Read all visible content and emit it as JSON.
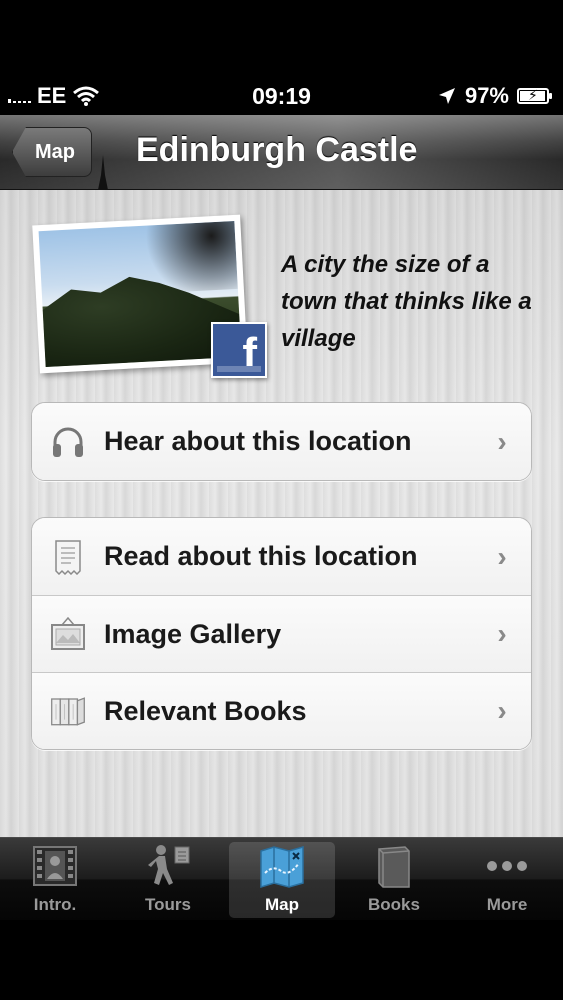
{
  "status_bar": {
    "carrier": "EE",
    "time": "09:19",
    "battery_percent": "97%",
    "battery_level": 0.97
  },
  "nav": {
    "back_label": "Map",
    "title": "Edinburgh Castle"
  },
  "header": {
    "tagline": "A city the size of a town that thinks like a village",
    "facebook_glyph": "f"
  },
  "menu_groups": [
    [
      {
        "label": "Hear about this location",
        "icon": "headphones-icon"
      }
    ],
    [
      {
        "label": "Read about this location",
        "icon": "document-icon"
      },
      {
        "label": "Image Gallery",
        "icon": "picture-icon"
      },
      {
        "label": "Relevant Books",
        "icon": "books-icon"
      }
    ]
  ],
  "tabs": [
    {
      "label": "Intro.",
      "icon": "film-icon",
      "active": false
    },
    {
      "label": "Tours",
      "icon": "walking-icon",
      "active": false
    },
    {
      "label": "Map",
      "icon": "map-icon",
      "active": true
    },
    {
      "label": "Books",
      "icon": "book-icon",
      "active": false
    },
    {
      "label": "More",
      "icon": "more-icon",
      "active": false
    }
  ],
  "colors": {
    "facebook_blue": "#3b5998",
    "tab_active_text": "#ffffff",
    "tab_inactive_text": "#9a9a9a"
  }
}
